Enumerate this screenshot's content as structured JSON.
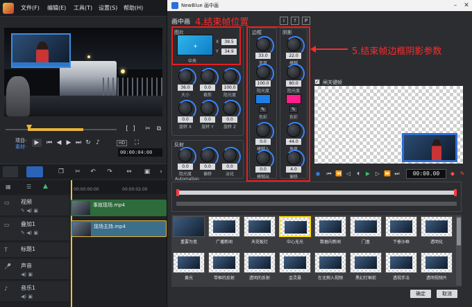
{
  "left": {
    "menu": [
      "文件(F)",
      "编辑(E)",
      "工具(T)",
      "设置(S)",
      "帮助(H)"
    ],
    "project_label": "项目-",
    "clip_label": "素材-",
    "timecode": "00:00:04:00",
    "zoom_label": "HD",
    "ruler_ticks": [
      "00:00:00:00",
      "00:00:02:00"
    ],
    "tracks": [
      {
        "name": "视频",
        "icon": "video-track-icon",
        "clip": "事故现场.mp4"
      },
      {
        "name": "叠加1",
        "icon": "overlay-track-icon",
        "clip": "现场主持.mp4"
      },
      {
        "name": "标题1",
        "icon": "title-track-icon",
        "clip": ""
      },
      {
        "name": "声音",
        "icon": "voice-track-icon",
        "clip": ""
      },
      {
        "name": "音乐1",
        "icon": "music-track-icon",
        "clip": ""
      }
    ]
  },
  "dialog": {
    "title": "NewBlue 画中画",
    "header": "画中画",
    "header_buttons": [
      "i",
      "?",
      "P"
    ],
    "annotation_4": "4.结束帧位置",
    "annotation_5": "5.结束帧边框阴影参数",
    "image_section": {
      "title": "图片",
      "x_label": "X",
      "x_value": "39.5",
      "y_label": "Y",
      "y_value": "34.9",
      "center_label": "中央"
    },
    "image_knobs": [
      {
        "value": "36.0",
        "name": "大小"
      },
      {
        "value": "0.0",
        "name": "裁剪"
      },
      {
        "value": "100.0",
        "name": "阻光度"
      },
      {
        "value": "0.0",
        "name": "旋转 X"
      },
      {
        "value": "0.0",
        "name": "旋转 Y"
      },
      {
        "value": "0.0",
        "name": "旋转 Z"
      }
    ],
    "reflection_section": {
      "title": "反射",
      "knobs": [
        {
          "value": "0.0",
          "name": "阻光度"
        },
        {
          "value": "0.0",
          "name": "偏移"
        },
        {
          "value": "0.0",
          "name": "淡化"
        }
      ]
    },
    "border_section": {
      "title": "边框",
      "knobs_top": [
        {
          "value": "33.0",
          "name": "宽度"
        },
        {
          "value": "100.0",
          "name": "阻光度"
        }
      ],
      "color_label": "色彩",
      "color": "#1e7fe6",
      "knobs_bottom": [
        {
          "value": "0.0",
          "name": "模糊入"
        },
        {
          "value": "0.0",
          "name": "模糊出"
        }
      ]
    },
    "shadow_section": {
      "title": "阴影",
      "knobs_top": [
        {
          "value": "22.0",
          "name": "模糊"
        },
        {
          "value": "80.0",
          "name": "阻光度"
        }
      ],
      "color_label": "色彩",
      "color": "#ff1e8c",
      "knobs_bottom": [
        {
          "value": "44.0",
          "name": "角度"
        },
        {
          "value": "4.0",
          "name": "偏移"
        }
      ]
    },
    "checkbox_label": "闸关键帧",
    "timecode": "00:00.00",
    "automation_label": "Automation",
    "presets_row1": [
      "重要为宽",
      "广播新闻",
      "天花板灯",
      "中心无光",
      "数据向新闻",
      "门盒",
      "下垂沙框",
      "透明化"
    ],
    "presets_row2": [
      "黄光",
      "带框的反射",
      "透明的反射",
      "金灵悬",
      "在北侧入视频",
      "黑幻灯框前",
      "透视手法",
      "透明视频片"
    ],
    "ok_label": "确定",
    "cancel_label": "取消",
    "colors": {
      "accent": "#3a86ff",
      "annotation": "#ff2b2b"
    }
  }
}
